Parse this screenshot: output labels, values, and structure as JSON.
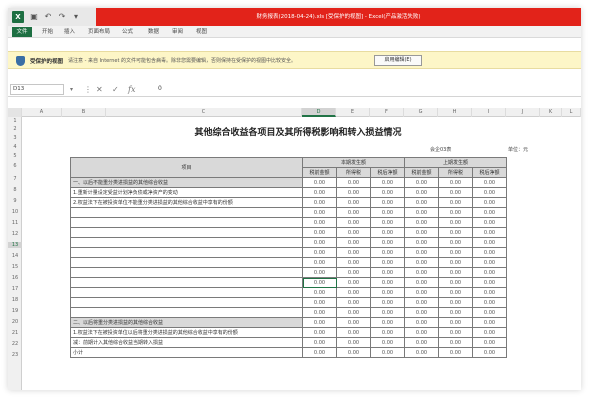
{
  "titlebar": {
    "document_title": "财务报表(2018-04-24).xls [受保护的视图] - Excel(产品激活失败)"
  },
  "ribbon": {
    "file_tab": "文件",
    "tabs": [
      "开始",
      "插入",
      "页面布局",
      "公式",
      "数据",
      "审阅",
      "视图"
    ]
  },
  "message_bar": {
    "title": "受保护的视图",
    "text": "请注意 - 来自 Internet 的文件可能包含病毒。除非您需要编辑，否则保持在受保护的视图中比较安全。",
    "button": "启用编辑(E)"
  },
  "formula_bar": {
    "name_box": "D13",
    "value": "0"
  },
  "columns": [
    "A",
    "B",
    "C",
    "D",
    "E",
    "F",
    "G",
    "H",
    "I",
    "J",
    "K",
    "L"
  ],
  "rows": [
    "1",
    "2",
    "3",
    "4",
    "5",
    "6",
    "7",
    "8",
    "9",
    "10",
    "11",
    "12",
    "13",
    "14",
    "15",
    "16",
    "17",
    "18",
    "19",
    "20",
    "21",
    "22",
    "23"
  ],
  "sheet": {
    "title": "其他综合收益各项目及其所得税影响和转入损益情况",
    "company_label": "会企03表",
    "unit_label": "单位：元",
    "header": {
      "item": "项目",
      "current_period": "本期发生额",
      "prior_period": "上期发生额",
      "sub": [
        "税前金额",
        "所得税",
        "税后净额",
        "税前金额",
        "所得税",
        "税后净额"
      ]
    },
    "lines": [
      {
        "label": "一、以后不能重分类进损益的其他综合收益",
        "values": [
          "0.00",
          "0.00",
          "0.00",
          "0.00",
          "0.00",
          "0.00"
        ],
        "shade": true
      },
      {
        "label": "1.重新计量设定受益计划净负债或净资产的变动",
        "values": [
          "0.00",
          "0.00",
          "0.00",
          "0.00",
          "0.00",
          "0.00"
        ],
        "shade": false
      },
      {
        "label": "2.权益法下在被投资单位不能重分类进损益的其他综合收益中享有的份额",
        "values": [
          "0.00",
          "0.00",
          "0.00",
          "0.00",
          "0.00",
          "0.00"
        ],
        "shade": false
      },
      {
        "label": "",
        "values": [
          "0.00",
          "0.00",
          "0.00",
          "0.00",
          "0.00",
          "0.00"
        ],
        "shade": false
      },
      {
        "label": "",
        "values": [
          "0.00",
          "0.00",
          "0.00",
          "0.00",
          "0.00",
          "0.00"
        ],
        "shade": false
      },
      {
        "label": "",
        "values": [
          "0.00",
          "0.00",
          "0.00",
          "0.00",
          "0.00",
          "0.00"
        ],
        "shade": false
      },
      {
        "label": "",
        "values": [
          "0.00",
          "0.00",
          "0.00",
          "0.00",
          "0.00",
          "0.00"
        ],
        "shade": false
      },
      {
        "label": "",
        "values": [
          "0.00",
          "0.00",
          "0.00",
          "0.00",
          "0.00",
          "0.00"
        ],
        "shade": false
      },
      {
        "label": "",
        "values": [
          "0.00",
          "0.00",
          "0.00",
          "0.00",
          "0.00",
          "0.00"
        ],
        "shade": false
      },
      {
        "label": "",
        "values": [
          "0.00",
          "0.00",
          "0.00",
          "0.00",
          "0.00",
          "0.00"
        ],
        "shade": false
      },
      {
        "label": "",
        "values": [
          "0.00",
          "0.00",
          "0.00",
          "0.00",
          "0.00",
          "0.00"
        ],
        "shade": false
      },
      {
        "label": "",
        "values": [
          "0.00",
          "0.00",
          "0.00",
          "0.00",
          "0.00",
          "0.00"
        ],
        "shade": false
      },
      {
        "label": "",
        "values": [
          "0.00",
          "0.00",
          "0.00",
          "0.00",
          "0.00",
          "0.00"
        ],
        "shade": false
      },
      {
        "label": "",
        "values": [
          "0.00",
          "0.00",
          "0.00",
          "0.00",
          "0.00",
          "0.00"
        ],
        "shade": false
      },
      {
        "label": "二、以后将重分类进损益的其他综合收益",
        "values": [
          "0.00",
          "0.00",
          "0.00",
          "0.00",
          "0.00",
          "0.00"
        ],
        "shade": true
      },
      {
        "label": "1.权益法下在被投资单位以后将重分类进损益的其他综合收益中享有的份额",
        "values": [
          "0.00",
          "0.00",
          "0.00",
          "0.00",
          "0.00",
          "0.00"
        ],
        "shade": false
      },
      {
        "label": "减：前期计入其他综合收益当期转入损益",
        "values": [
          "0.00",
          "0.00",
          "0.00",
          "0.00",
          "0.00",
          "0.00"
        ],
        "shade": false
      },
      {
        "label": "小计",
        "values": [
          "0.00",
          "0.00",
          "0.00",
          "0.00",
          "0.00",
          "0.00"
        ],
        "shade": false
      }
    ]
  }
}
